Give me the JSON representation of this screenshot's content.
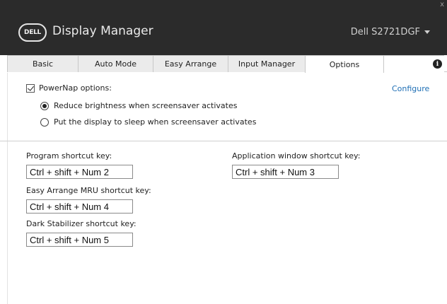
{
  "window": {
    "brand": "DELL",
    "app_title": "Display Manager",
    "monitor": "Dell S2721DGF",
    "close_glyph": "x"
  },
  "tabs": [
    {
      "label": "Basic",
      "active": false
    },
    {
      "label": "Auto Mode",
      "active": false
    },
    {
      "label": "Easy Arrange",
      "active": false
    },
    {
      "label": "Input Manager",
      "active": false
    },
    {
      "label": "Options",
      "active": true
    }
  ],
  "info_icon": "i",
  "powernap": {
    "label": "PowerNap options:",
    "checked": true,
    "configure_label": "Configure",
    "options": [
      {
        "label": "Reduce brightness when screensaver activates",
        "selected": true
      },
      {
        "label": "Put the display to sleep when screensaver activates",
        "selected": false
      }
    ]
  },
  "shortcuts": {
    "program": {
      "label": "Program shortcut key:",
      "value": "Ctrl + shift + Num 2"
    },
    "app_window": {
      "label": "Application window shortcut key:",
      "value": "Ctrl + shift + Num 3"
    },
    "easy_arrange_mru": {
      "label": "Easy Arrange MRU shortcut key:",
      "value": "Ctrl + shift + Num 4"
    },
    "dark_stabilizer": {
      "label": "Dark Stabilizer shortcut key:",
      "value": "Ctrl + shift + Num 5"
    }
  }
}
